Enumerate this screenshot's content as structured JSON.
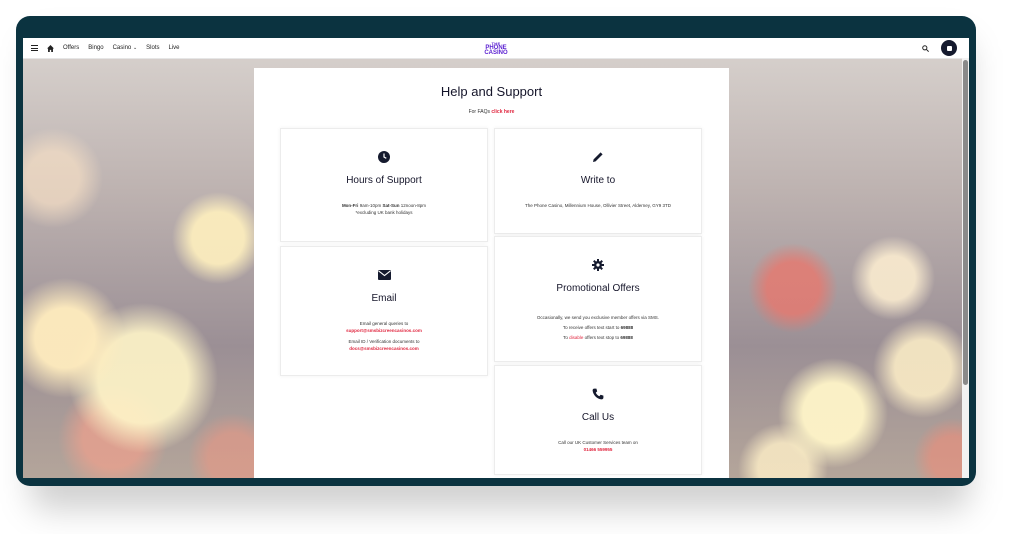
{
  "nav": {
    "items": [
      "Offers",
      "Bingo",
      "Casino",
      "Slots",
      "Live"
    ],
    "logo_line1": "THE",
    "logo_line2": "PHONE",
    "logo_line3": "CASINO"
  },
  "page": {
    "title": "Help and Support",
    "faq_prefix": "For FAQs",
    "faq_link": "click here"
  },
  "cards": {
    "hours": {
      "icon": "clock-icon",
      "title": "Hours of Support",
      "line1_a": "Mon-Fri",
      "line1_b": "9am-10pm",
      "line1_c": "Sat-Sun",
      "line1_d": "12noon-8pm",
      "line2": "*excluding UK bank holidays"
    },
    "write": {
      "icon": "pencil-icon",
      "title": "Write to",
      "line1": "The Phone Casino, Millennium House, Ollivier Street, Alderney, GY9 3TD"
    },
    "email": {
      "icon": "envelope-icon",
      "title": "Email",
      "line1": "Email general queries to",
      "link1": "support@smsbizcreencasinos.com",
      "line2": "Email ID / Verification documents to",
      "link2": "docs@smsbizcreencasinos.com"
    },
    "promo": {
      "icon": "gear-icon",
      "title": "Promotional Offers",
      "line1": "Occasionally, we send you exclusive member offers via SMS.",
      "line2_a": "To receive offers text start to",
      "line2_b": "69888",
      "line3_a": "To",
      "line3_b": "disable",
      "line3_c": "offers text stop to",
      "line3_d": "69888"
    },
    "call": {
      "icon": "phone-icon",
      "title": "Call Us",
      "line1": "Call our UK Customer Services team on",
      "link1": "01466 559955"
    }
  },
  "colors": {
    "accent": "#e0263f",
    "brand": "#5a1fd1",
    "frame": "#0b3340"
  }
}
